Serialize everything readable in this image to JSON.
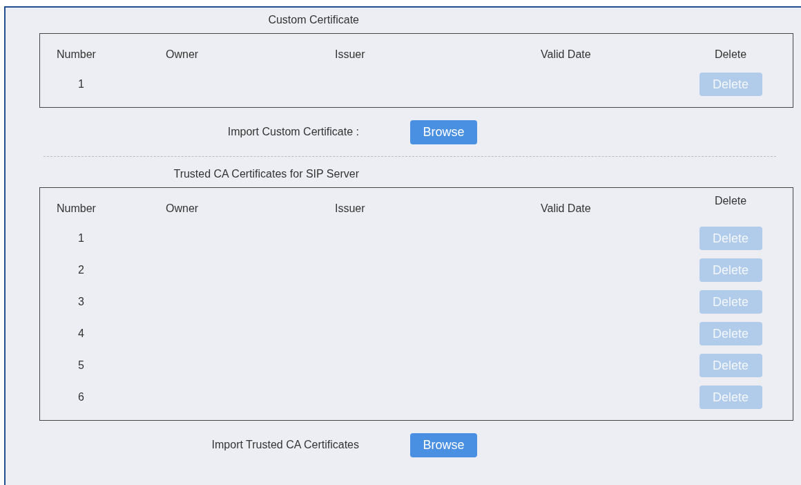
{
  "sections": [
    {
      "title": "Custom Certificate",
      "columns": [
        "Number",
        "Owner",
        "Issuer",
        "Valid Date",
        "Delete"
      ],
      "rows": [
        {
          "number": "1",
          "delete": {
            "label": "Delete",
            "disabled": true
          }
        }
      ],
      "import": {
        "label": "Import Custom Certificate :",
        "button": "Browse"
      }
    },
    {
      "title": "Trusted CA Certificates for SIP Server",
      "columns": [
        "Number",
        "Owner",
        "Issuer",
        "Valid Date",
        "Delete"
      ],
      "rows": [
        {
          "number": "1",
          "delete": {
            "label": "Delete",
            "disabled": true
          }
        },
        {
          "number": "2",
          "delete": {
            "label": "Delete",
            "disabled": true
          }
        },
        {
          "number": "3",
          "delete": {
            "label": "Delete",
            "disabled": true
          }
        },
        {
          "number": "4",
          "delete": {
            "label": "Delete",
            "disabled": true
          }
        },
        {
          "number": "5",
          "delete": {
            "label": "Delete",
            "disabled": true
          }
        },
        {
          "number": "6",
          "delete": {
            "label": "Delete",
            "disabled": true
          }
        }
      ],
      "import": {
        "label": "Import Trusted CA Certificates",
        "button": "Browse"
      }
    }
  ]
}
